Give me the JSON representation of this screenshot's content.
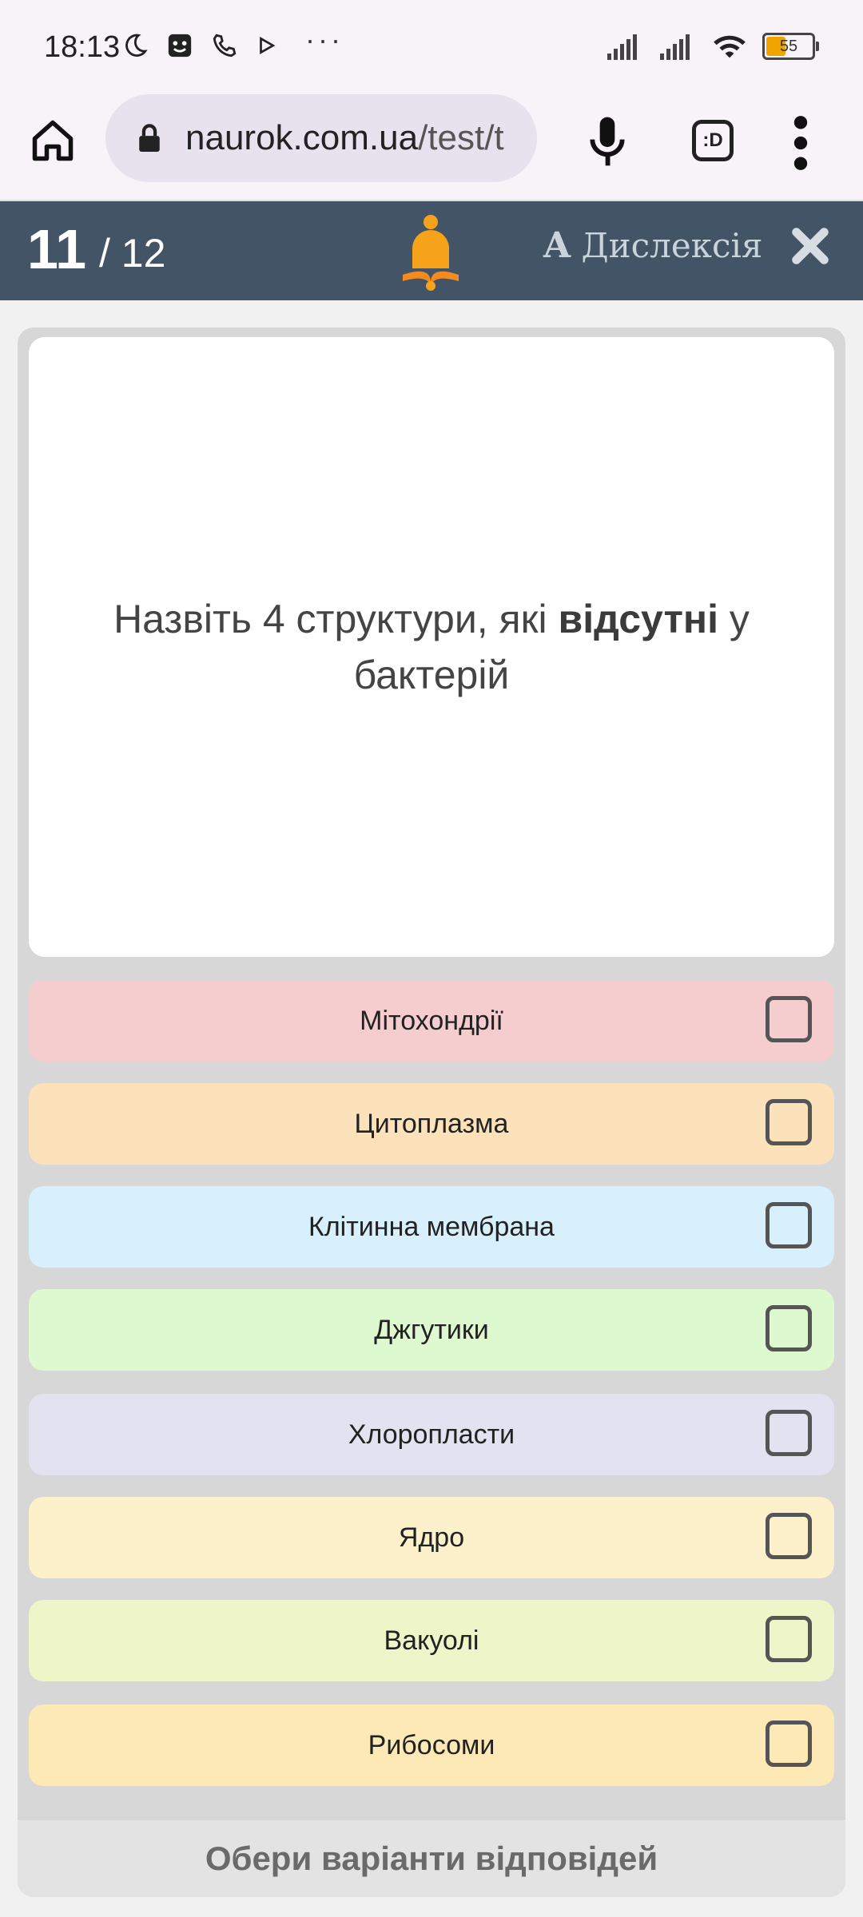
{
  "status_bar": {
    "time": "18:13",
    "battery": "55",
    "icons": [
      "moon-icon",
      "face-icon",
      "phone-wifi-icon",
      "play-icon",
      "more-dots",
      "signal-icon",
      "signal-icon",
      "wifi-icon",
      "battery-icon"
    ],
    "more": "···"
  },
  "browser": {
    "url_host": "naurok.com.ua",
    "url_path": "/test/t",
    "tab_switch_label": ":D"
  },
  "quiz_header": {
    "current": "11",
    "total": "/ 12",
    "dyslexia_letter": "A",
    "dyslexia_label": "Дислексія",
    "accent_color": "#f7a31a",
    "background_color": "#425466"
  },
  "question": {
    "text_before": "Назвіть 4 структури, які ",
    "text_bold": "відсутні",
    "text_after": " у бактерій"
  },
  "options": [
    {
      "label": "Мітохондрії",
      "color": "#f6cdce",
      "checked": false
    },
    {
      "label": "Цитоплазма",
      "color": "#fbe2bb",
      "checked": false
    },
    {
      "label": "Клітинна мембрана",
      "color": "#d8f0fb",
      "checked": false
    },
    {
      "label": "Джгутики",
      "color": "#def9d0",
      "checked": false
    },
    {
      "label": "Хлоропласти",
      "color": "#e2e2f0",
      "checked": false
    },
    {
      "label": "Ядро",
      "color": "#fdf1cc",
      "checked": false
    },
    {
      "label": "Вакуолі",
      "color": "#eef5c8",
      "checked": false
    },
    {
      "label": "Рибосоми",
      "color": "#fde9b5",
      "checked": false
    }
  ],
  "footer": {
    "label": "Обери варіанти відповідей"
  }
}
